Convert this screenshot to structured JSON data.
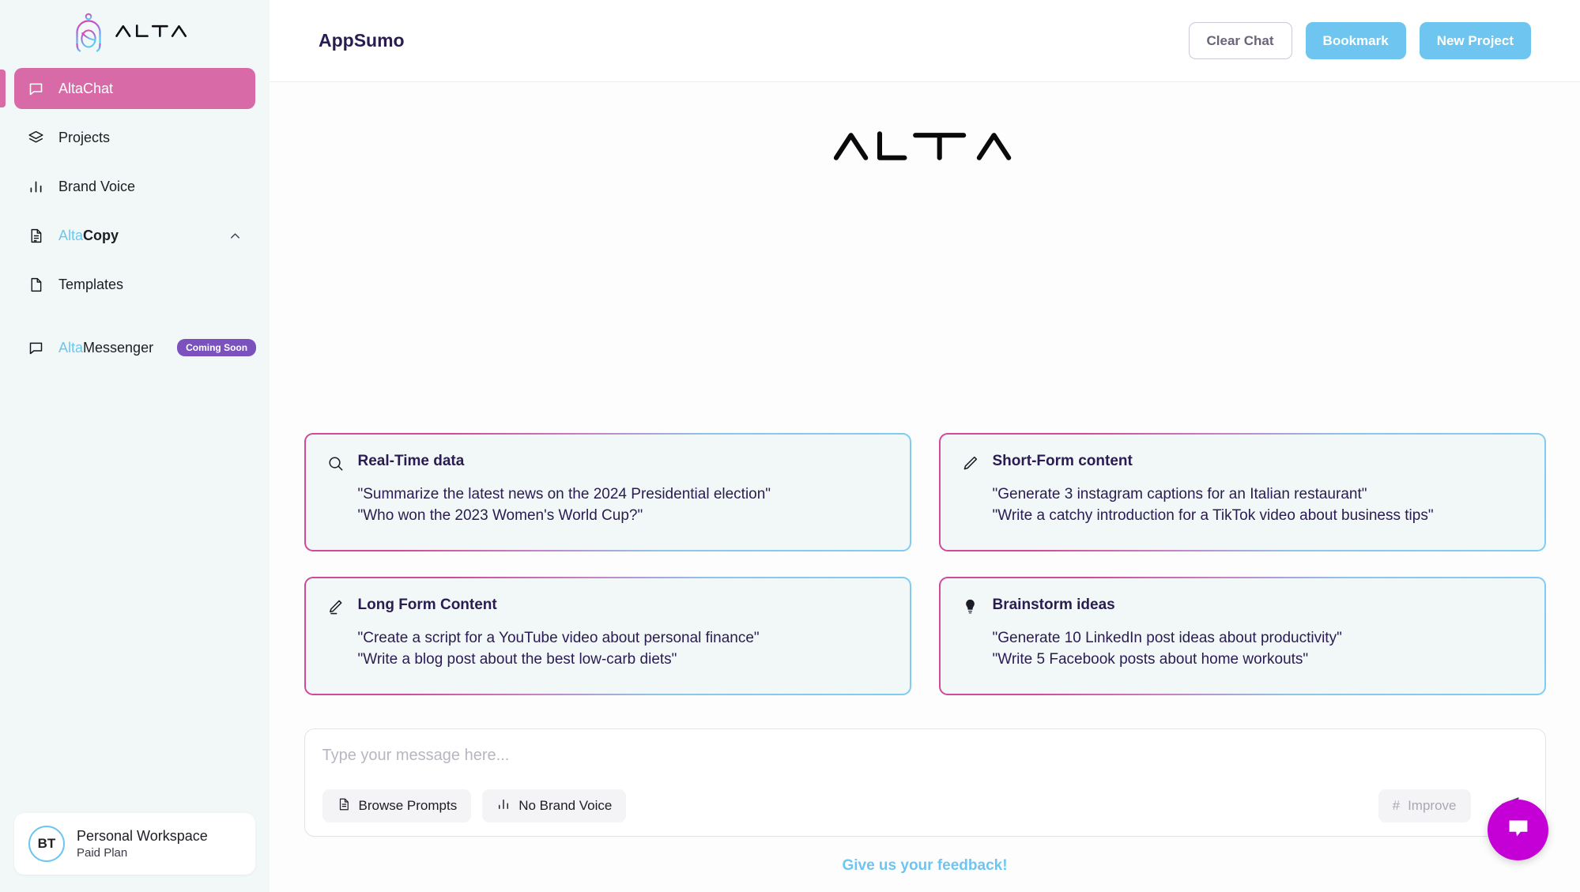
{
  "brand": {
    "logo_wordmark": "ALTA",
    "logo_icon": "alta-robot-head-icon",
    "accent_pink": "#d96aa8",
    "accent_cyan": "#6ec6f0",
    "accent_purple": "#7b52bd",
    "accent_magenta": "#c400d6",
    "title_color": "#2a1b52"
  },
  "sidebar": {
    "items": [
      {
        "label": "AltaChat",
        "icon": "chat-bubble-icon",
        "active": true
      },
      {
        "label": "Projects",
        "icon": "layers-icon",
        "active": false
      },
      {
        "label": "Brand Voice",
        "icon": "bar-chart-icon",
        "active": false
      },
      {
        "label_prefix": "Alta",
        "label": "Copy",
        "icon": "document-text-icon",
        "active": false,
        "chevron": "chevron-up-icon"
      },
      {
        "label": "Templates",
        "icon": "file-icon",
        "active": false
      },
      {
        "label_prefix": "Alta",
        "label": "Messenger",
        "icon": "chat-bubble-icon",
        "active": false,
        "badge": "Coming Soon"
      }
    ],
    "workspace": {
      "initials": "BT",
      "name": "Personal Workspace",
      "plan": "Paid Plan"
    }
  },
  "header": {
    "title": "AppSumo",
    "buttons": [
      {
        "label": "Clear Chat",
        "style": "outline"
      },
      {
        "label": "Bookmark",
        "style": "blue"
      },
      {
        "label": "New Project",
        "style": "blue"
      }
    ]
  },
  "main": {
    "hero_wordmark": "ALTA",
    "cards": [
      {
        "title": "Real-Time data",
        "icon": "search-icon",
        "lines": [
          "\"Summarize the latest news on the 2024 Presidential election\"",
          "\"Who won the 2023 Women's World Cup?\""
        ]
      },
      {
        "title": "Short-Form content",
        "icon": "pencil-icon",
        "lines": [
          "\"Generate 3 instagram captions for an Italian restaurant\"",
          "\"Write a catchy introduction for a TikTok video about business tips\""
        ]
      },
      {
        "title": "Long Form Content",
        "icon": "pencil-line-icon",
        "lines": [
          "\"Create a script for a YouTube video about personal finance\"",
          "\"Write a blog post about the best low-carb diets\""
        ]
      },
      {
        "title": "Brainstorm ideas",
        "icon": "lightbulb-icon",
        "lines": [
          "\"Generate 10 LinkedIn post ideas about productivity\"",
          "\"Write 5 Facebook posts about home workouts\""
        ]
      }
    ],
    "composer": {
      "placeholder": "Type your message here...",
      "value": "",
      "browse_prompts_label": "Browse Prompts",
      "brand_voice_label": "No Brand Voice",
      "improve_label": "Improve",
      "improve_prefix": "#",
      "send_icon": "send-paper-plane-icon"
    },
    "feedback_label": "Give us your feedback!",
    "chat_widget_icon": "chat-bubble-icon"
  }
}
